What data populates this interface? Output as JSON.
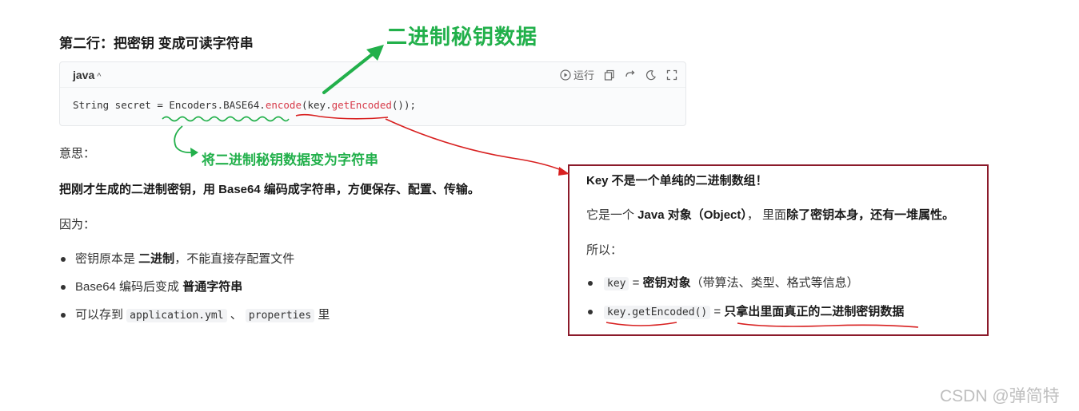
{
  "heading": "第二行：把密钥 变成可读字符串",
  "code": {
    "language": "java",
    "caret": "^",
    "toolbar": {
      "run_label": "运行"
    },
    "line_parts": [
      "String secret = Encoders.BASE64.",
      "encode",
      "(key.",
      "getEncoded",
      "());"
    ]
  },
  "annotations": {
    "title": "二进制秘钥数据",
    "subtitle": "将二进制秘钥数据变为字符串"
  },
  "meaning_label": "意思：",
  "meaning_text": "把刚才生成的二进制密钥，用 Base64 编码成字符串，方便保存、配置、传输。",
  "because_label": "因为：",
  "bullets": {
    "b1_pre": "密钥原本是 ",
    "b1_bold": "二进制",
    "b1_post": "，不能直接存配置文件",
    "b2_pre": "Base64 编码后变成 ",
    "b2_bold": "普通字符串",
    "b3_pre": "可以存到 ",
    "b3_code1": "application.yml",
    "b3_mid": " 、 ",
    "b3_code2": "properties",
    "b3_post": " 里"
  },
  "box": {
    "title": "Key 不是一个单纯的二进制数组！",
    "l2_pre": "它是一个 ",
    "l2_bold": "Java 对象（Object）",
    "l2_mid": "， 里面",
    "l2_bold2": "除了密钥本身，还有一堆属性。",
    "l3": "所以：",
    "i1_code": "key",
    "i1_eq": " = ",
    "i1_bold": "密钥对象",
    "i1_rest": "（带算法、类型、格式等信息）",
    "i2_code": "key.getEncoded()",
    "i2_eq": " = ",
    "i2_bold": "只拿出里面真正的二进制密钥数据"
  },
  "watermark": "CSDN @弹简特",
  "colors": {
    "green": "#22b04b",
    "red": "#d82020",
    "box_border": "#8b1a2a"
  }
}
